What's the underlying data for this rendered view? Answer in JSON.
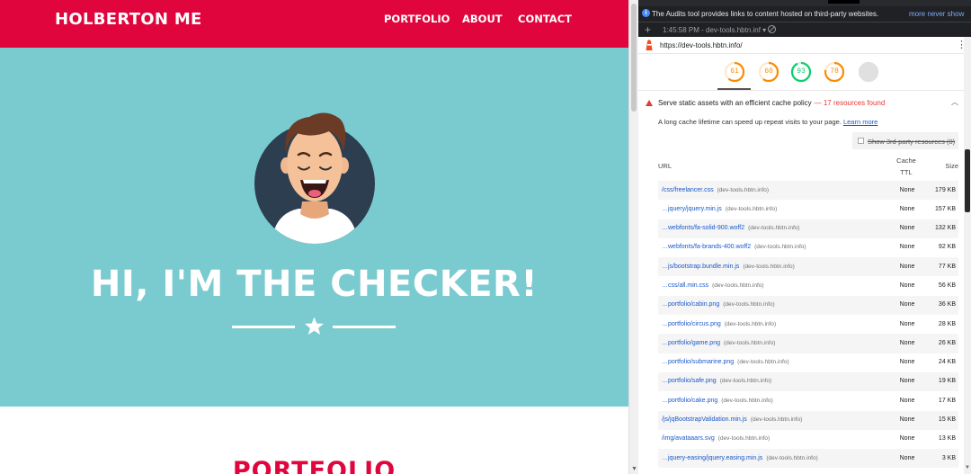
{
  "site": {
    "brand": "HOLBERTON ME",
    "nav": [
      "PORTFOLIO",
      "ABOUT",
      "CONTACT"
    ],
    "hero_title": "HI, I'M THE CHECKER!",
    "section_heading": "PORTFOLIO",
    "colors": {
      "primary": "#e0053d",
      "hero": "#79cbd0",
      "avatar_bg": "#2c3e50"
    }
  },
  "devtools": {
    "info": {
      "text": "The Audits tool provides links to content hosted on third-party websites.",
      "more": "more never show"
    },
    "toolbar": {
      "report": "1:45:58 PM - dev-tools.hbtn.inf ▾"
    },
    "url": "https://dev-tools.hbtn.info/",
    "gauges": [
      {
        "score": "61",
        "value": 61,
        "color": "#fb8c00"
      },
      {
        "score": "60",
        "value": 60,
        "color": "#fb8c00"
      },
      {
        "score": "93",
        "value": 93,
        "color": "#0cce6b"
      },
      {
        "score": "78",
        "value": 78,
        "color": "#fb8c00"
      },
      {
        "score": "",
        "value": 0,
        "color": "#bdbdbd"
      }
    ],
    "audit": {
      "title": "Serve static assets with an efficient cache policy",
      "detail": "— 17 resources found",
      "description": "A long cache lifetime can speed up repeat visits to your page.",
      "learn_more": "Learn more",
      "third_party_label": "Show 3rd-party resources (0)",
      "headers": {
        "url": "URL",
        "ttl": "Cache TTL",
        "size": "Size"
      },
      "rows": [
        {
          "url": "/css/freelancer.css",
          "host": "(dev-tools.hbtn.info)",
          "ttl": "None",
          "size": "179 KB"
        },
        {
          "url": "…jquery/jquery.min.js",
          "host": "(dev-tools.hbtn.info)",
          "ttl": "None",
          "size": "157 KB"
        },
        {
          "url": "…webfonts/fa-solid-900.woff2",
          "host": "(dev-tools.hbtn.info)",
          "ttl": "None",
          "size": "132 KB"
        },
        {
          "url": "…webfonts/fa-brands-400.woff2",
          "host": "(dev-tools.hbtn.info)",
          "ttl": "None",
          "size": "92 KB"
        },
        {
          "url": "…js/bootstrap.bundle.min.js",
          "host": "(dev-tools.hbtn.info)",
          "ttl": "None",
          "size": "77 KB"
        },
        {
          "url": "…css/all.min.css",
          "host": "(dev-tools.hbtn.info)",
          "ttl": "None",
          "size": "56 KB"
        },
        {
          "url": "…portfolio/cabin.png",
          "host": "(dev-tools.hbtn.info)",
          "ttl": "None",
          "size": "36 KB"
        },
        {
          "url": "…portfolio/circus.png",
          "host": "(dev-tools.hbtn.info)",
          "ttl": "None",
          "size": "28 KB"
        },
        {
          "url": "…portfolio/game.png",
          "host": "(dev-tools.hbtn.info)",
          "ttl": "None",
          "size": "26 KB"
        },
        {
          "url": "…portfolio/submarine.png",
          "host": "(dev-tools.hbtn.info)",
          "ttl": "None",
          "size": "24 KB"
        },
        {
          "url": "…portfolio/safe.png",
          "host": "(dev-tools.hbtn.info)",
          "ttl": "None",
          "size": "19 KB"
        },
        {
          "url": "…portfolio/cake.png",
          "host": "(dev-tools.hbtn.info)",
          "ttl": "None",
          "size": "17 KB"
        },
        {
          "url": "/js/jqBootstrapValidation.min.js",
          "host": "(dev-tools.hbtn.info)",
          "ttl": "None",
          "size": "15 KB"
        },
        {
          "url": "/img/avataaars.svg",
          "host": "(dev-tools.hbtn.info)",
          "ttl": "None",
          "size": "13 KB"
        },
        {
          "url": "…jquery-easing/jquery.easing.min.js",
          "host": "(dev-tools.hbtn.info)",
          "ttl": "None",
          "size": "3 KB"
        }
      ]
    }
  }
}
